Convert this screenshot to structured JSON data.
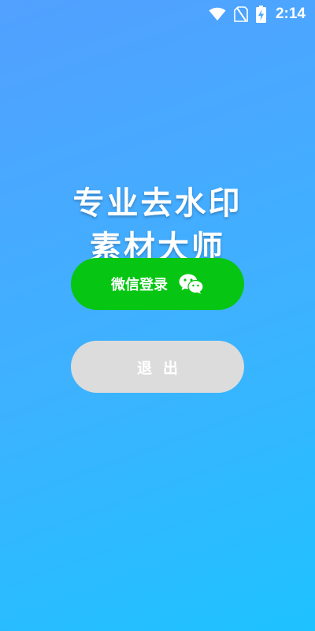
{
  "status_bar": {
    "time": "2:14",
    "icons": [
      "wifi-icon",
      "no-sim-icon",
      "battery-charging-icon"
    ]
  },
  "hero": {
    "line1": "专业去水印",
    "line2": "素材大师"
  },
  "buttons": {
    "wechat_login": "微信登录",
    "exit": "退出"
  },
  "colors": {
    "background_gradient_start": "#52a0ff",
    "background_gradient_end": "#1ec2ff",
    "wechat_green": "#06c613",
    "exit_gray": "#dcdcdc",
    "text": "#ffffff"
  }
}
